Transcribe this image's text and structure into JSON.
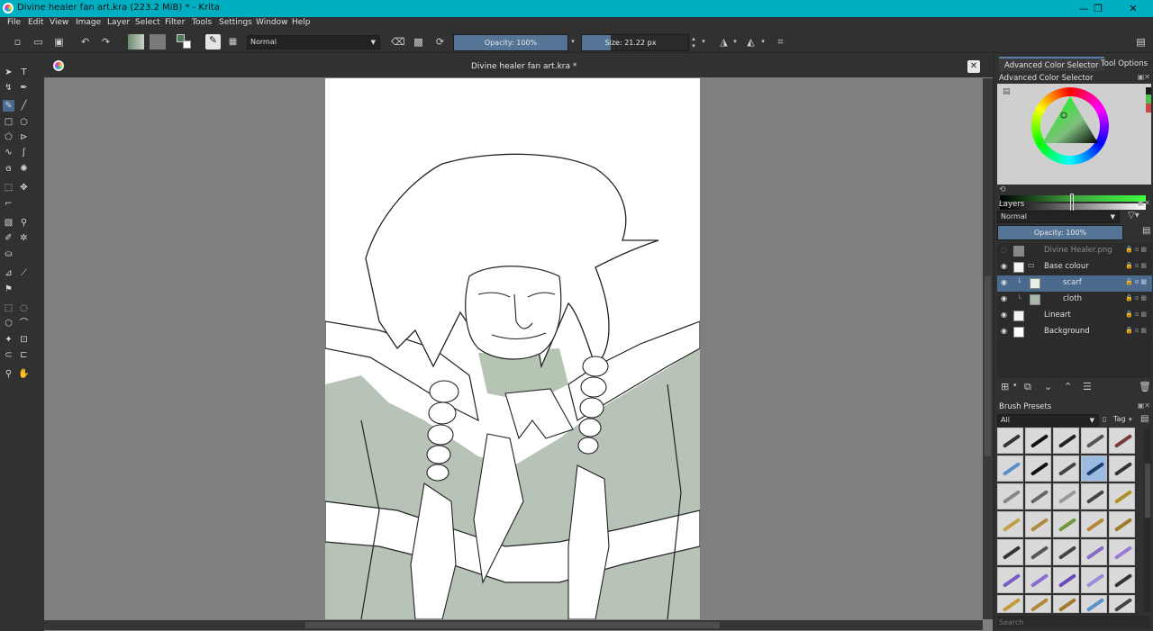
{
  "window": {
    "title": "Divine healer fan art.kra (223.2 MiB)  * - Krita",
    "minimize": "—",
    "maximize": "❐",
    "close": "✕"
  },
  "menu": [
    "File",
    "Edit",
    "View",
    "Image",
    "Layer",
    "Select",
    "Filter",
    "Tools",
    "Settings",
    "Window",
    "Help"
  ],
  "toolbar": {
    "blend_mode": "Normal",
    "opacity_label": "Opacity: 100%",
    "opacity_value": 1.0,
    "size_label": "Size: 21.22 px",
    "size_value": 21.22
  },
  "document": {
    "tab_title": "Divine healer fan art.kra *",
    "close": "✕"
  },
  "dock": {
    "tabs": [
      "Advanced Color Selector",
      "Tool Options"
    ],
    "color_selector_title": "Advanced Color Selector",
    "layers_title": "Layers",
    "layer_blend": "Normal",
    "layer_opacity": "Opacity:  100%",
    "layers": [
      {
        "name": "Divine Healer.png",
        "visible": false,
        "selected": false,
        "indent": 0
      },
      {
        "name": "Base colour",
        "visible": true,
        "selected": false,
        "indent": 0
      },
      {
        "name": "scarf",
        "visible": true,
        "selected": true,
        "indent": 1
      },
      {
        "name": "cloth",
        "visible": true,
        "selected": false,
        "indent": 1
      },
      {
        "name": "Lineart",
        "visible": true,
        "selected": false,
        "indent": 0
      },
      {
        "name": "Background",
        "visible": true,
        "selected": false,
        "indent": 0
      }
    ],
    "brush_presets_title": "Brush Presets",
    "brush_filter": "All",
    "brush_tag": "Tag",
    "search_placeholder": "Search"
  },
  "colors": {
    "titlebar": "#00aec1",
    "panel": "#313131",
    "canvas_bg": "#7f7f7f",
    "accent": "#557596",
    "wash_green": "#a8b8a8"
  }
}
